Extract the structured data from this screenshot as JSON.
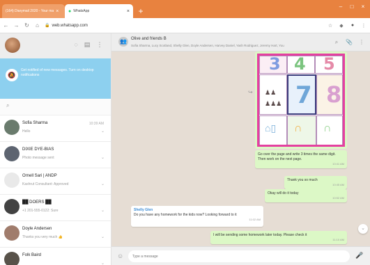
{
  "browser": {
    "tabs": [
      {
        "label": "(164) Diarymail 2020 - Your ma"
      },
      {
        "label": "WhatsApp"
      }
    ],
    "new_tab": "+",
    "address": "web.whatsapp.com",
    "window_controls": [
      "–",
      "□",
      "×"
    ]
  },
  "sidebar": {
    "banner": "Get notified of new messages. Turn on desktop notifications",
    "chats": [
      {
        "name": "Sofia Sharma",
        "preview": "Hello",
        "time": "10:39 AM",
        "avatar_color": "#6a7b6d"
      },
      {
        "name": "DIXIE DYE-BIAS",
        "preview": "Photo message sent",
        "time": "",
        "avatar_color": "#5d6470"
      },
      {
        "name": "Ornell Sari | ANDP",
        "preview": "Kashrut Consultant: Approved",
        "time": "",
        "avatar_color": "#e9e9e9"
      },
      {
        "name": "██ DOERS ██",
        "preview": "+1 201-555-0122: Sure",
        "time": "",
        "avatar_color": "#424242"
      },
      {
        "name": "Doyle Andersen",
        "preview": "Thanks you very much 👍",
        "time": "",
        "avatar_color": "#a07c6c"
      },
      {
        "name": "Folk Baird",
        "preview": "",
        "time": "",
        "avatar_color": "#58524a"
      }
    ]
  },
  "chat": {
    "title": "Olive and friends B",
    "subtitle": "Sofia Sharma, Lucy Scotland, Shelly Glen, Doyle Andersen, Harvey Daniel, Yash Rodriguez, Jeremy Hart, You",
    "image_digits": [
      "3",
      "4",
      "5",
      "7",
      "8"
    ],
    "messages": [
      {
        "text": "Go over the page and write 3 times the same digit. Then work on the next page.",
        "time": "10:41 AM"
      },
      {
        "text": "Thank you so much",
        "time": "10:45 AM"
      },
      {
        "text": "Okay will do it today",
        "time": "10:52 AM"
      }
    ],
    "incoming": {
      "sender": "Shelly Glen",
      "text": "Do you have any homework for the kids now? Looking forward to it",
      "time": "11:02 AM"
    },
    "last_message": {
      "text": "I will be sending some homework later today. Please check it",
      "time": "11:10 AM"
    },
    "composer_placeholder": "Type a message"
  },
  "colors": {
    "browser_accent": "#e8823f",
    "banner": "#8dd0ef",
    "outgoing_bubble": "#dcf8c6",
    "wallpaper": "#e6ddd4",
    "image_frame": "#e43fa0"
  }
}
